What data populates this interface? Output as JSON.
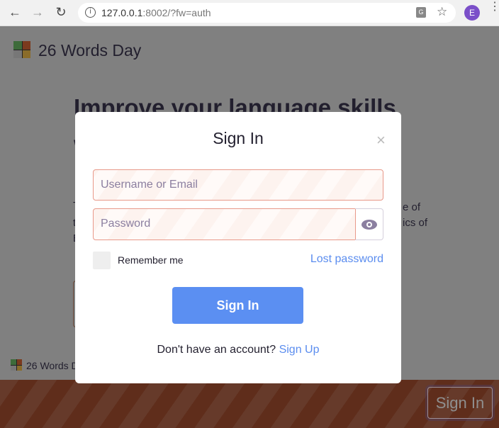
{
  "browser": {
    "url_host": "127.0.0.1",
    "url_rest": ":8002/?fw=auth",
    "profile_initial": "E"
  },
  "page": {
    "brand": "26 Words Day",
    "hero": "Improve your language skills",
    "fragments": {
      "w": "W",
      "t1": "T",
      "t2": "t",
      "t3": "E",
      "r1": "e of",
      "r2": "ics of"
    },
    "footer_brand": "26 Words D",
    "bg_signin": "Sign In"
  },
  "modal": {
    "title": "Sign In",
    "close": "×",
    "username_placeholder": "Username or Email",
    "password_placeholder": "Password",
    "remember": "Remember me",
    "lost_password": "Lost password",
    "submit": "Sign In",
    "no_account": "Don't have an account?",
    "signup": "Sign Up"
  },
  "colors": {
    "accent": "#5b8ff2",
    "link": "#5b8def",
    "error_border": "#e8998a",
    "band": "#5f2d1b"
  }
}
